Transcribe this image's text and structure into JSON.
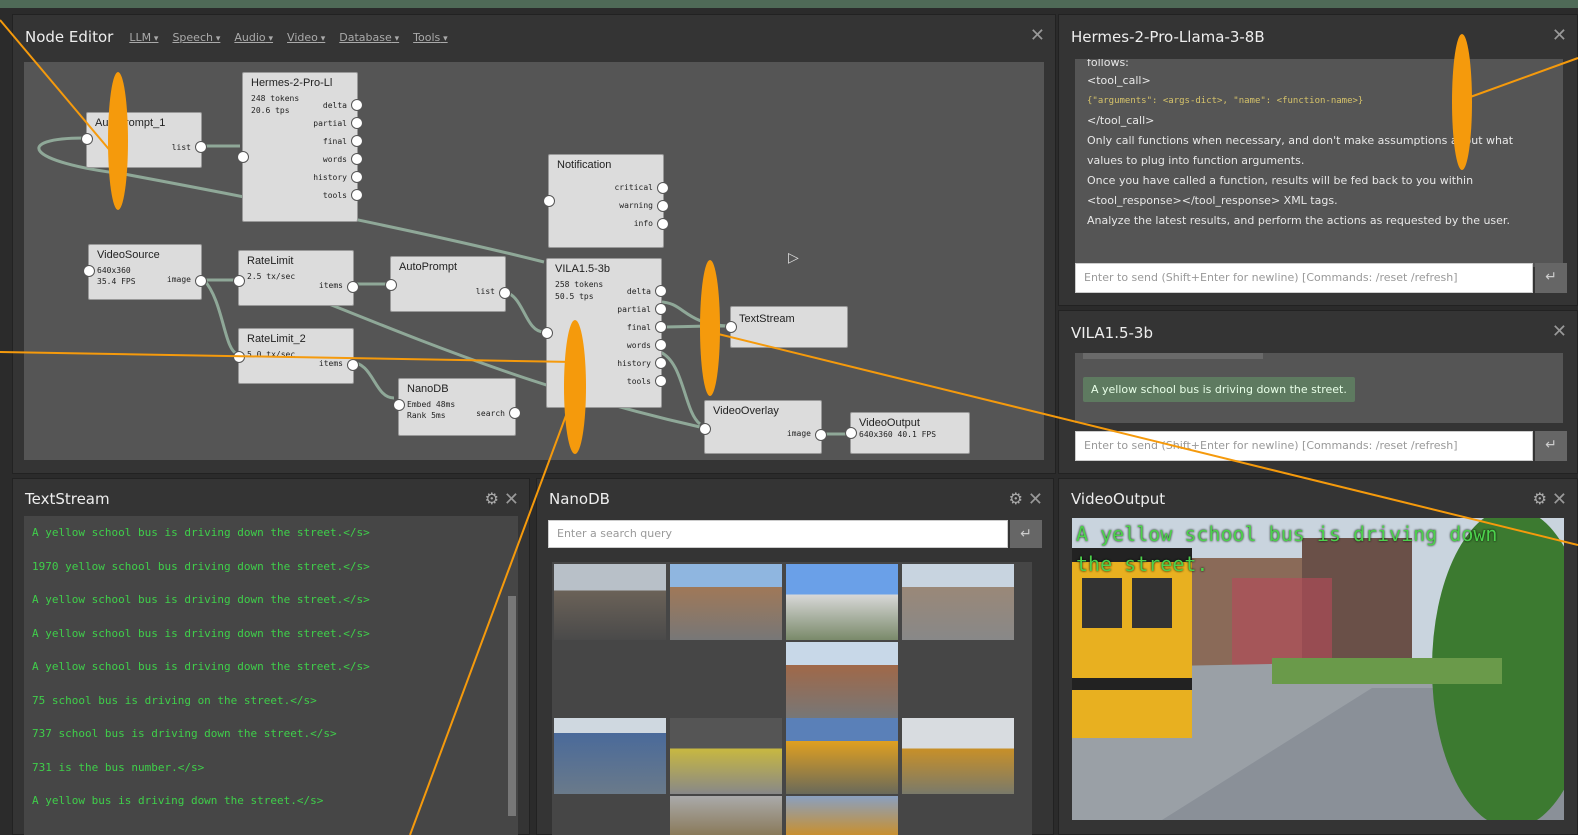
{
  "node_editor": {
    "title": "Node Editor",
    "menus": [
      "LLM",
      "Speech",
      "Audio",
      "Video",
      "Database",
      "Tools"
    ],
    "close": "✕",
    "nodes": {
      "autoprompt1": {
        "title": "AutoPrompt_1",
        "out": "list"
      },
      "hermes": {
        "title": "Hermes-2-Pro-Ll",
        "stats": [
          "248 tokens",
          "20.6 tps"
        ],
        "outs": [
          "delta",
          "partial",
          "final",
          "words",
          "history",
          "tools"
        ]
      },
      "notification": {
        "title": "Notification",
        "outs": [
          "critical",
          "warning",
          "info"
        ]
      },
      "videosource": {
        "title": "VideoSource",
        "stats": [
          "640x360",
          "35.4 FPS"
        ],
        "out": "image"
      },
      "ratelimit": {
        "title": "RateLimit",
        "stats": [
          "2.5 tx/sec"
        ],
        "out": "items"
      },
      "autoprompt": {
        "title": "AutoPrompt",
        "out": "list"
      },
      "vila": {
        "title": "VILA1.5-3b",
        "stats": [
          "258 tokens",
          "50.5 tps"
        ],
        "outs": [
          "delta",
          "partial",
          "final",
          "words",
          "history",
          "tools"
        ]
      },
      "textstream": {
        "title": "TextStream"
      },
      "ratelimit2": {
        "title": "RateLimit_2",
        "stats": [
          "5.0 tx/sec"
        ],
        "out": "items"
      },
      "nanodb": {
        "title": "NanoDB",
        "stats": [
          "Embed 48ms",
          "Rank 5ms"
        ],
        "out": "search"
      },
      "videooverlay": {
        "title": "VideoOverlay",
        "out": "image"
      },
      "videooutput": {
        "title": "VideoOutput",
        "stats": [
          "640x360 40.1 FPS"
        ]
      }
    }
  },
  "hermes_panel": {
    "title": "Hermes-2-Pro-Llama-3-8B",
    "lines": [
      "follows:",
      "<tool_call>",
      "{\"arguments\": <args-dict>, \"name\": <function-name>}",
      "</tool_call>",
      "Only call functions when necessary, and don't make assumptions about what",
      "values to plug into function arguments.",
      "Once you have called a function, results will be fed back to you within",
      "<tool_response></tool_response> XML tags.",
      "Analyze the latest results, and perform the actions as requested by the user."
    ],
    "input_placeholder": "Enter to send (Shift+Enter for newline)    [Commands:  /reset /refresh]",
    "send": "↵"
  },
  "vila_panel": {
    "title": "VILA1.5-3b",
    "message": "A yellow school bus is driving down the street.",
    "input_placeholder": "Enter to send (Shift+Enter for newline)    [Commands:  /reset /refresh]",
    "send": "↵"
  },
  "textstream_panel": {
    "title": "TextStream",
    "lines": [
      "A yellow school bus is driving down the street.</s>",
      "1970 yellow school bus driving down the street.</s>",
      "A yellow school bus is driving down the street.</s>",
      "A yellow school bus is driving down the street.</s>",
      "A yellow school bus is driving down the street.</s>",
      "75 school bus is driving on the street.</s>",
      "737 school bus is driving down the street.</s>",
      "731 is the bus number.</s>",
      "A yellow bus is driving down the street.</s>"
    ]
  },
  "nanodb_panel": {
    "title": "NanoDB",
    "search_placeholder": "Enter a search query",
    "send": "↵"
  },
  "videooutput_panel": {
    "title": "VideoOutput",
    "overlay_line1": "A yellow school bus is driving down",
    "overlay_line2": "the street."
  },
  "icons": {
    "gear": "⚙",
    "close": "✕"
  },
  "colors": {
    "accent_orange": "#f59a0c",
    "stream_green": "#3fcf4a",
    "panel": "#343434"
  }
}
